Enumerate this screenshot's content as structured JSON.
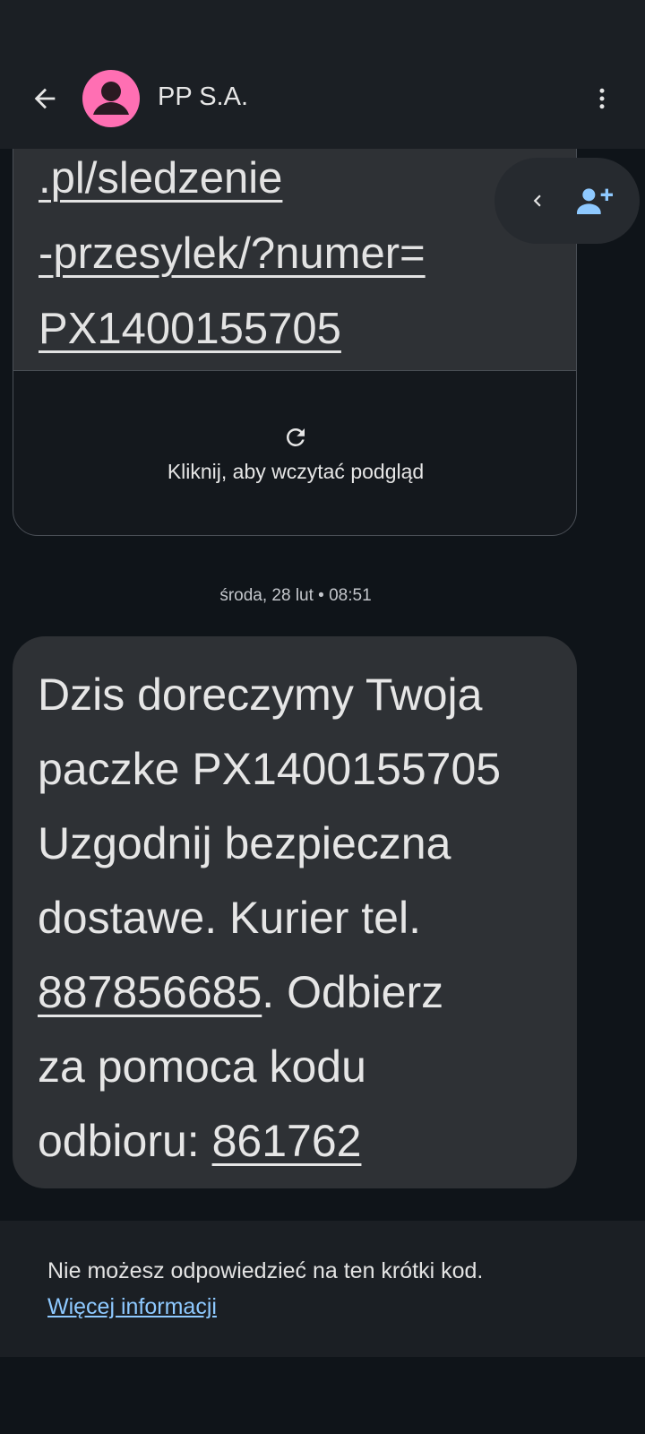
{
  "header": {
    "contact_name": "PP S.A."
  },
  "link_card": {
    "url_lines": [
      ".pl/sledzenie",
      "-przesylek/?numer=",
      "PX1400155705"
    ],
    "preview_label": "Kliknij, aby wczytać podgląd"
  },
  "thread": {
    "timestamp": "środa, 28 lut • 08:51"
  },
  "message": {
    "text_before_phone": "Dzis doreczymy Twoja\npaczke PX1400155705\nUzgodnij bezpieczna\ndostawe. Kurier tel.\n",
    "phone": "887856685",
    "text_after_phone": ". Odbierz\nza pomoca kodu\nodbioru: ",
    "code": "861762"
  },
  "footer_notice": {
    "text": "Nie możesz odpowiedzieć na ten krótki kod.",
    "link": "Więcej informacji"
  },
  "colors": {
    "avatar": "#ff6fb3",
    "link_blue": "#8ec9ff",
    "bubble": "#2e3135",
    "background": "#0f1419"
  },
  "icons": {
    "back": "arrow-left-icon",
    "avatar": "person-icon",
    "more": "more-vert-icon",
    "refresh": "refresh-icon",
    "chevron": "chevron-left-icon",
    "add_contact": "person-add-icon"
  }
}
